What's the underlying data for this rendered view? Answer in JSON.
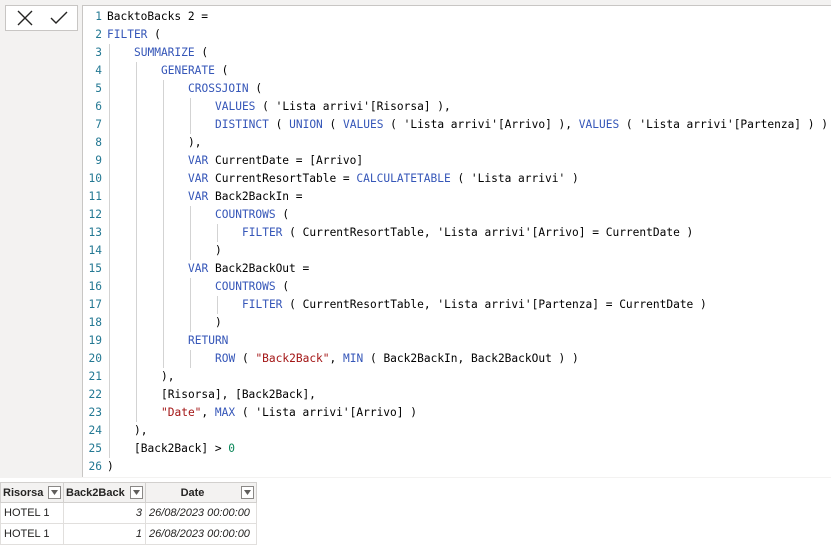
{
  "formula_bar": {
    "cancel_icon": "close-x-icon",
    "commit_icon": "checkmark-icon",
    "lines": [
      {
        "n": "1",
        "indent": 0,
        "parts": [
          [
            "t",
            "BacktoBacks 2 ="
          ]
        ]
      },
      {
        "n": "2",
        "indent": 0,
        "parts": [
          [
            "k",
            "FILTER"
          ],
          [
            "t",
            " ("
          ]
        ]
      },
      {
        "n": "3",
        "indent": 1,
        "parts": [
          [
            "k",
            "SUMMARIZE"
          ],
          [
            "t",
            " ("
          ]
        ]
      },
      {
        "n": "4",
        "indent": 2,
        "parts": [
          [
            "k",
            "GENERATE"
          ],
          [
            "t",
            " ("
          ]
        ]
      },
      {
        "n": "5",
        "indent": 3,
        "parts": [
          [
            "k",
            "CROSSJOIN"
          ],
          [
            "t",
            " ("
          ]
        ]
      },
      {
        "n": "6",
        "indent": 4,
        "parts": [
          [
            "k",
            "VALUES"
          ],
          [
            "t",
            " ( 'Lista arrivi'[Risorsa] ),"
          ]
        ]
      },
      {
        "n": "7",
        "indent": 4,
        "parts": [
          [
            "k",
            "DISTINCT"
          ],
          [
            "t",
            " ( "
          ],
          [
            "k",
            "UNION"
          ],
          [
            "t",
            " ( "
          ],
          [
            "k",
            "VALUES"
          ],
          [
            "t",
            " ( 'Lista arrivi'[Arrivo] ), "
          ],
          [
            "k",
            "VALUES"
          ],
          [
            "t",
            " ( 'Lista arrivi'[Partenza] ) ) )"
          ]
        ]
      },
      {
        "n": "8",
        "indent": 3,
        "parts": [
          [
            "t",
            "),"
          ]
        ]
      },
      {
        "n": "9",
        "indent": 3,
        "parts": [
          [
            "k",
            "VAR"
          ],
          [
            "t",
            " CurrentDate = [Arrivo]"
          ]
        ]
      },
      {
        "n": "10",
        "indent": 3,
        "parts": [
          [
            "k",
            "VAR"
          ],
          [
            "t",
            " CurrentResortTable = "
          ],
          [
            "k",
            "CALCULATETABLE"
          ],
          [
            "t",
            " ( 'Lista arrivi' )"
          ]
        ]
      },
      {
        "n": "11",
        "indent": 3,
        "parts": [
          [
            "k",
            "VAR"
          ],
          [
            "t",
            " Back2BackIn ="
          ]
        ]
      },
      {
        "n": "12",
        "indent": 4,
        "parts": [
          [
            "k",
            "COUNTROWS"
          ],
          [
            "t",
            " ("
          ]
        ]
      },
      {
        "n": "13",
        "indent": 5,
        "parts": [
          [
            "k",
            "FILTER"
          ],
          [
            "t",
            " ( CurrentResortTable, 'Lista arrivi'[Arrivo] = CurrentDate )"
          ]
        ]
      },
      {
        "n": "14",
        "indent": 4,
        "parts": [
          [
            "t",
            ")"
          ]
        ]
      },
      {
        "n": "15",
        "indent": 3,
        "parts": [
          [
            "k",
            "VAR"
          ],
          [
            "t",
            " Back2BackOut ="
          ]
        ]
      },
      {
        "n": "16",
        "indent": 4,
        "parts": [
          [
            "k",
            "COUNTROWS"
          ],
          [
            "t",
            " ("
          ]
        ]
      },
      {
        "n": "17",
        "indent": 5,
        "parts": [
          [
            "k",
            "FILTER"
          ],
          [
            "t",
            " ( CurrentResortTable, 'Lista arrivi'[Partenza] = CurrentDate )"
          ]
        ]
      },
      {
        "n": "18",
        "indent": 4,
        "parts": [
          [
            "t",
            ")"
          ]
        ]
      },
      {
        "n": "19",
        "indent": 3,
        "parts": [
          [
            "k",
            "RETURN"
          ]
        ]
      },
      {
        "n": "20",
        "indent": 4,
        "parts": [
          [
            "k",
            "ROW"
          ],
          [
            "t",
            " ( "
          ],
          [
            "s",
            "\"Back2Back\""
          ],
          [
            "t",
            ", "
          ],
          [
            "k",
            "MIN"
          ],
          [
            "t",
            " ( Back2BackIn, Back2BackOut ) )"
          ]
        ]
      },
      {
        "n": "21",
        "indent": 2,
        "parts": [
          [
            "t",
            "),"
          ]
        ]
      },
      {
        "n": "22",
        "indent": 2,
        "parts": [
          [
            "t",
            "[Risorsa], [Back2Back],"
          ]
        ]
      },
      {
        "n": "23",
        "indent": 2,
        "parts": [
          [
            "s",
            "\"Date\""
          ],
          [
            "t",
            ", "
          ],
          [
            "k",
            "MAX"
          ],
          [
            "t",
            " ( 'Lista arrivi'[Arrivo] )"
          ]
        ]
      },
      {
        "n": "24",
        "indent": 1,
        "parts": [
          [
            "t",
            "),"
          ]
        ]
      },
      {
        "n": "25",
        "indent": 1,
        "parts": [
          [
            "t",
            "[Back2Back] > "
          ],
          [
            "n",
            "0"
          ]
        ]
      },
      {
        "n": "26",
        "indent": 0,
        "parts": [
          [
            "t",
            ")"
          ]
        ]
      }
    ]
  },
  "table": {
    "columns": [
      {
        "label": "Risorsa",
        "key": "risorsa"
      },
      {
        "label": "Back2Back",
        "key": "back2back"
      },
      {
        "label": "Date",
        "key": "date"
      }
    ],
    "rows": [
      {
        "risorsa": "HOTEL 1",
        "back2back": "3",
        "date": "26/08/2023 00:00:00"
      },
      {
        "risorsa": "HOTEL 1",
        "back2back": "1",
        "date": "26/08/2023 00:00:00"
      }
    ],
    "filter_icon": "dropdown-filter-icon"
  }
}
